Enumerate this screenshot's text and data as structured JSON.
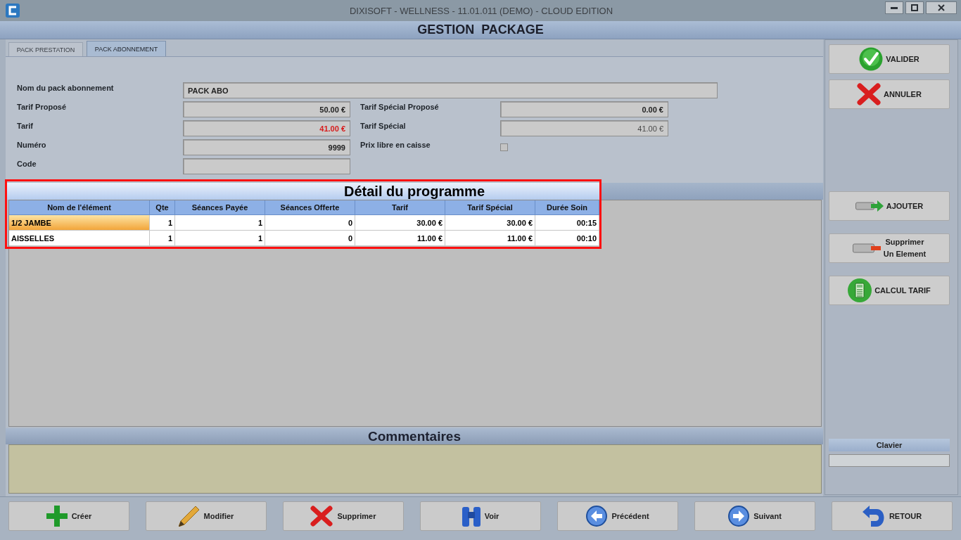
{
  "window": {
    "title": "DIXISOFT - WELLNESS - 11.01.011 (DEMO) - CLOUD EDITION"
  },
  "header": {
    "title": "GESTION PACKAGE"
  },
  "tabs": [
    {
      "label": "PACK PRESTATION",
      "selected": false
    },
    {
      "label": "PACK ABONNEMENT",
      "selected": true
    }
  ],
  "form": {
    "rows": [
      [
        {
          "kind": "wide",
          "label": "Nom du pack abonnement",
          "value": "PACK ABO",
          "warning": false,
          "disabled": false
        }
      ],
      [
        {
          "kind": "amount",
          "label": "Tarif Proposé",
          "value": "50.00 €",
          "warning": false,
          "disabled": false
        },
        {
          "kind": "amount",
          "label": "Tarif Spécial Proposé",
          "value": "0.00 €",
          "warning": false,
          "disabled": false
        }
      ],
      [
        {
          "kind": "amount",
          "label": "Tarif",
          "value": "41.00 €",
          "warning": true,
          "disabled": false
        },
        {
          "kind": "amount",
          "label": "Tarif Spécial",
          "value": "41.00 €",
          "warning": false,
          "disabled": true
        }
      ],
      [
        {
          "kind": "amount",
          "label": "Numéro",
          "value": "9999",
          "warning": false,
          "disabled": false
        },
        {
          "kind": "checkbox",
          "label": "Prix libre en caisse",
          "checked": false
        }
      ],
      [
        {
          "kind": "text",
          "label": "Code"
        }
      ]
    ]
  },
  "programme": {
    "title": "Détail du programme",
    "highlighted": true,
    "columns": [
      "Nom de l'élément",
      "Qte",
      "Séances Payée",
      "Séances Offerte",
      "Tarif",
      "Tarif Spécial",
      "Durée Soin"
    ],
    "rows": [
      {
        "selected": true,
        "cells": [
          "1/2 JAMBE",
          "1",
          "1",
          "0",
          "30.00 €",
          "30.00 €",
          "00:15"
        ]
      },
      {
        "selected": false,
        "cells": [
          "AISSELLES",
          "1",
          "1",
          "0",
          "11.00 €",
          "11.00 €",
          "00:10"
        ]
      }
    ]
  },
  "comments": {
    "title": "Commentaires"
  },
  "side_panel": {
    "actions": [
      "VALIDER",
      "ANNULER"
    ],
    "tools": [
      "AJOUTER",
      "Supprimer\nUn Element",
      "CALCUL TARIF"
    ],
    "keyboard": {
      "title": "Clavier"
    }
  },
  "toolbar": [
    "Créer",
    "Modifier",
    "Supprimer",
    "Voir",
    "Précédent",
    "Suivant",
    "RETOUR"
  ]
}
